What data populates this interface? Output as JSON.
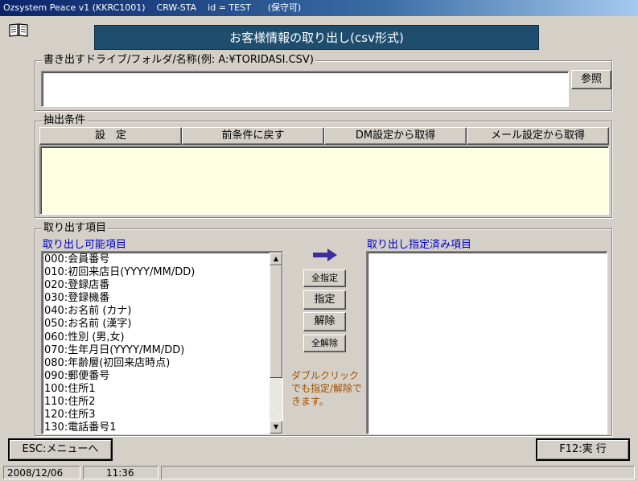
{
  "window": {
    "title": "Ozsystem Peace v1 (KKRC1001)    CRW-STA    id = TEST      (保守可)"
  },
  "banner": {
    "title": "お客様情報の取り出し(csv形式)"
  },
  "output_group": {
    "legend": "書き出すドライブ/フォルダ/名称(例: A:¥TORIDASI.CSV)",
    "path_value": "",
    "browse_label": "参照"
  },
  "condition_group": {
    "legend": "抽出条件",
    "buttons": [
      "設　定",
      "前条件に戻す",
      "DM設定から取得",
      "メール設定から取得"
    ],
    "condition_text": ""
  },
  "fields_group": {
    "legend": "取り出す項目",
    "available_label": "取り出し可能項目",
    "selected_label": "取り出し指定済み項目",
    "available_items": [
      "000:会員番号",
      "010:初回来店日(YYYY/MM/DD)",
      "020:登録店番",
      "030:登録機番",
      "040:お名前 (カナ)",
      "050:お名前 (漢字)",
      "060:性別  (男,女)",
      "070:生年月日(YYYY/MM/DD)",
      "080:年齢層(初回来店時点)",
      "090:郵便番号",
      "100:住所1",
      "110:住所2",
      "120:住所3",
      "130:電話番号1"
    ],
    "selected_items": [],
    "add_all_label": "全指定",
    "add_label": "指定",
    "remove_label": "解除",
    "remove_all_label": "全解除",
    "hint": "ダブルクリックでも指定/解除できます。"
  },
  "footer": {
    "esc_label": "ESC:メニューへ",
    "f12_label": "F12:実 行"
  },
  "statusbar": {
    "date": "2008/12/06",
    "time": "11:36"
  },
  "icons": {
    "book": "book-icon",
    "arrow": "arrow-right-icon"
  },
  "colors": {
    "banner_bg": "#1e4d6e",
    "list_header": "#0000c8",
    "hint_text": "#a05000",
    "condition_bg": "#ffffe1",
    "arrow": "#3c2ea0"
  }
}
